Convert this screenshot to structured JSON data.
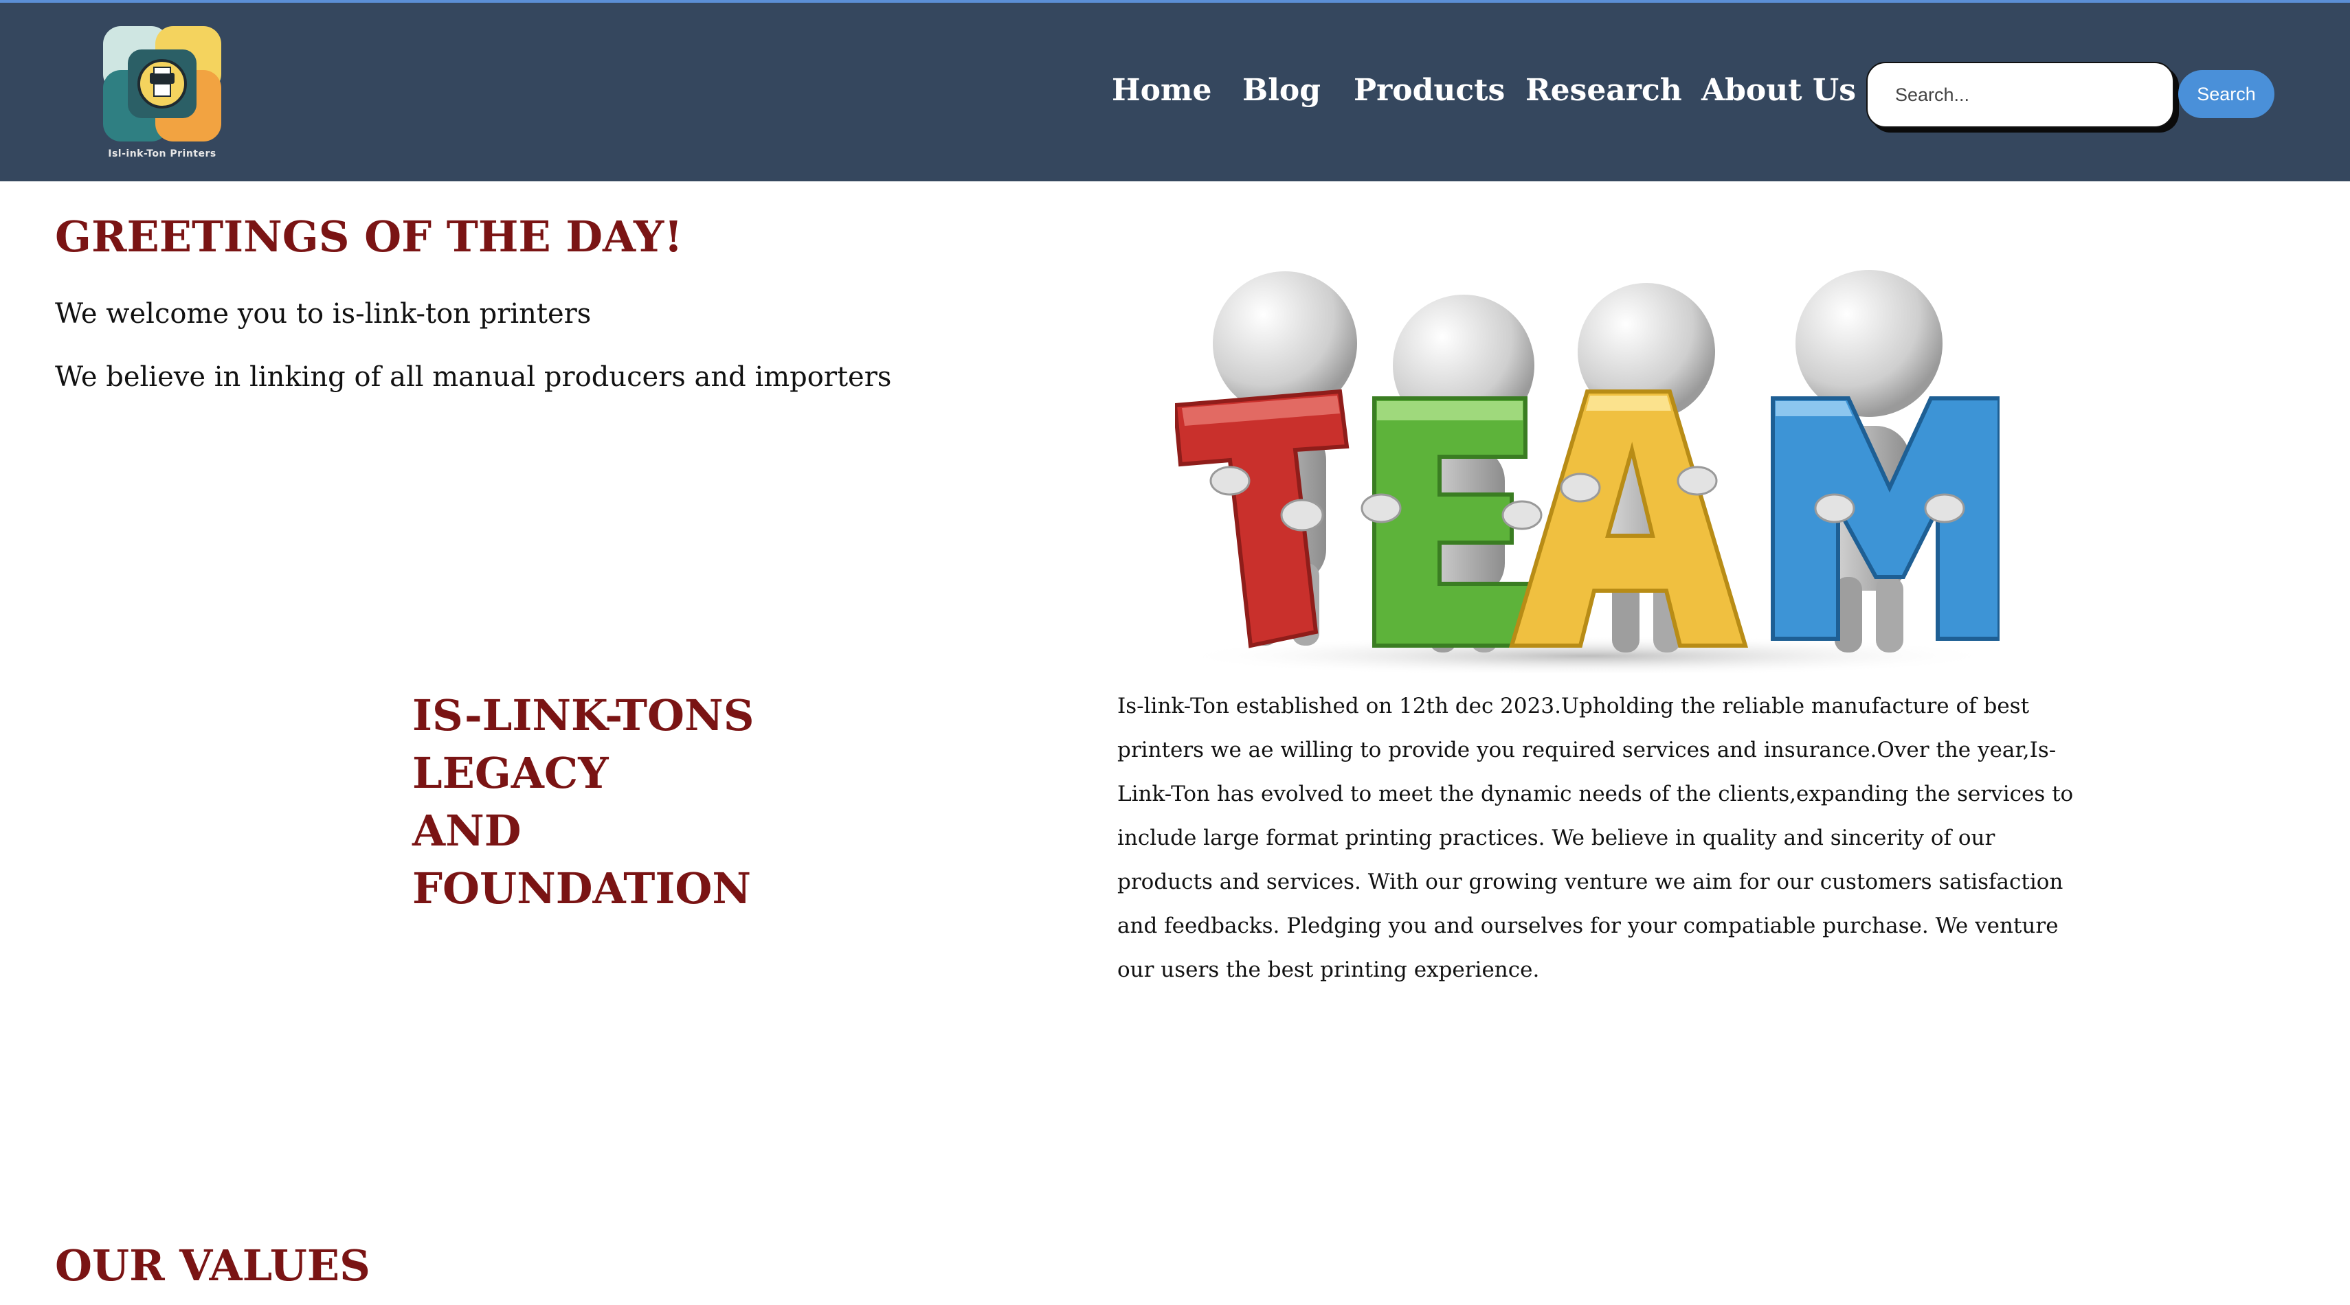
{
  "header": {
    "logo_text": "Isl-ink-Ton Printers",
    "nav": [
      {
        "label": "Home"
      },
      {
        "label": "Blog"
      },
      {
        "label": "Products"
      },
      {
        "label": "Research"
      },
      {
        "label": "About Us"
      }
    ],
    "search": {
      "placeholder": "Search...",
      "value": "",
      "button_label": "Search"
    }
  },
  "greeting": {
    "title": "GREETINGS OF THE DAY!",
    "lines": [
      "We welcome you to is-link-ton printers",
      "We believe in linking of all manual producers and importers"
    ]
  },
  "team_image": {
    "letters": [
      "T",
      "E",
      "A",
      "M"
    ],
    "colors": [
      "#c9302c",
      "#5db33a",
      "#f0c040",
      "#3d94d6"
    ]
  },
  "legacy": {
    "title_lines": [
      "IS-LINK-TONS LEGACY",
      "AND",
      "FOUNDATION"
    ],
    "body": "Is-link-Ton established on 12th dec 2023.Upholding the reliable manufacture of best printers we ae willing to provide you required services and insurance.Over the year,Is-Link-Ton has evolved to meet the dynamic needs of the clients,expanding the services to include large format printing practices. We believe in quality and sincerity of our products and services. With our growing venture we aim for our customers satisfaction and feedbacks. Pledging you and ourselves for your compatiable purchase. We venture our users the best printing experience."
  },
  "values": {
    "title": "OUR VALUES"
  },
  "colors": {
    "header_bg": "#35475e",
    "heading": "#7a1414",
    "search_button": "#4a90d9"
  }
}
